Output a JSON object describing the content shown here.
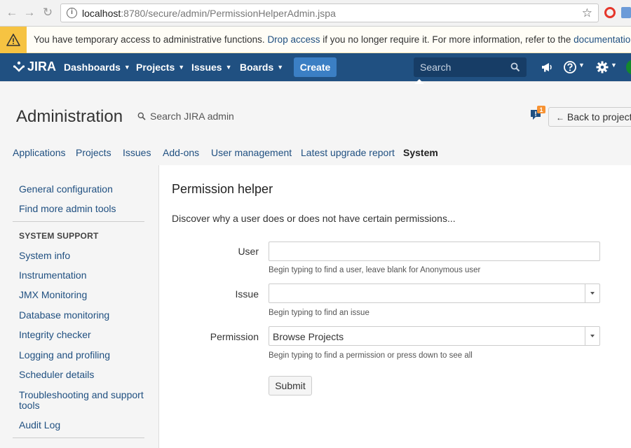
{
  "browser": {
    "url_host": "localhost",
    "url_path": ":8780/secure/admin/PermissionHelperAdmin.jspa"
  },
  "banner": {
    "text_before": "You have temporary access to administrative functions.",
    "drop_link": "Drop access",
    "text_middle": "if you no longer require it. For more information, refer to the",
    "doc_link": "documentation",
    "text_after": "."
  },
  "topnav": {
    "logo": "JIRA",
    "items": [
      {
        "label": "Dashboards"
      },
      {
        "label": "Projects"
      },
      {
        "label": "Issues"
      },
      {
        "label": "Boards"
      }
    ],
    "create_label": "Create",
    "search_placeholder": "Search",
    "feedback_count": "1",
    "colors": {
      "nav_bg": "#205081",
      "create_bg": "#3b7fc4",
      "search_bg": "#173d66"
    }
  },
  "admin": {
    "title": "Administration",
    "search_label": "Search JIRA admin",
    "back_label": "Back to project:",
    "tabs": [
      {
        "label": "Applications"
      },
      {
        "label": "Projects"
      },
      {
        "label": "Issues"
      },
      {
        "label": "Add-ons"
      },
      {
        "label": "User management"
      },
      {
        "label": "Latest upgrade report"
      },
      {
        "label": "System"
      }
    ],
    "active_tab": "System"
  },
  "sidebar": {
    "top_links": [
      {
        "label": "General configuration"
      },
      {
        "label": "Find more admin tools"
      }
    ],
    "section_heading": "SYSTEM SUPPORT",
    "section_links": [
      {
        "label": "System info"
      },
      {
        "label": "Instrumentation"
      },
      {
        "label": "JMX Monitoring"
      },
      {
        "label": "Database monitoring"
      },
      {
        "label": "Integrity checker"
      },
      {
        "label": "Logging and profiling"
      },
      {
        "label": "Scheduler details"
      },
      {
        "label": "Troubleshooting and support"
      },
      {
        "label": "tools"
      },
      {
        "label": "Audit Log"
      }
    ]
  },
  "main": {
    "title": "Permission helper",
    "description": "Discover why a user does or does not have certain permissions...",
    "form": {
      "user_label": "User",
      "user_value": "",
      "user_hint": "Begin typing to find a user, leave blank for Anonymous user",
      "issue_label": "Issue",
      "issue_value": "",
      "issue_hint": "Begin typing to find an issue",
      "permission_label": "Permission",
      "permission_value": "Browse Projects",
      "permission_hint": "Begin typing to find a permission or press down to see all",
      "submit_label": "Submit"
    }
  }
}
